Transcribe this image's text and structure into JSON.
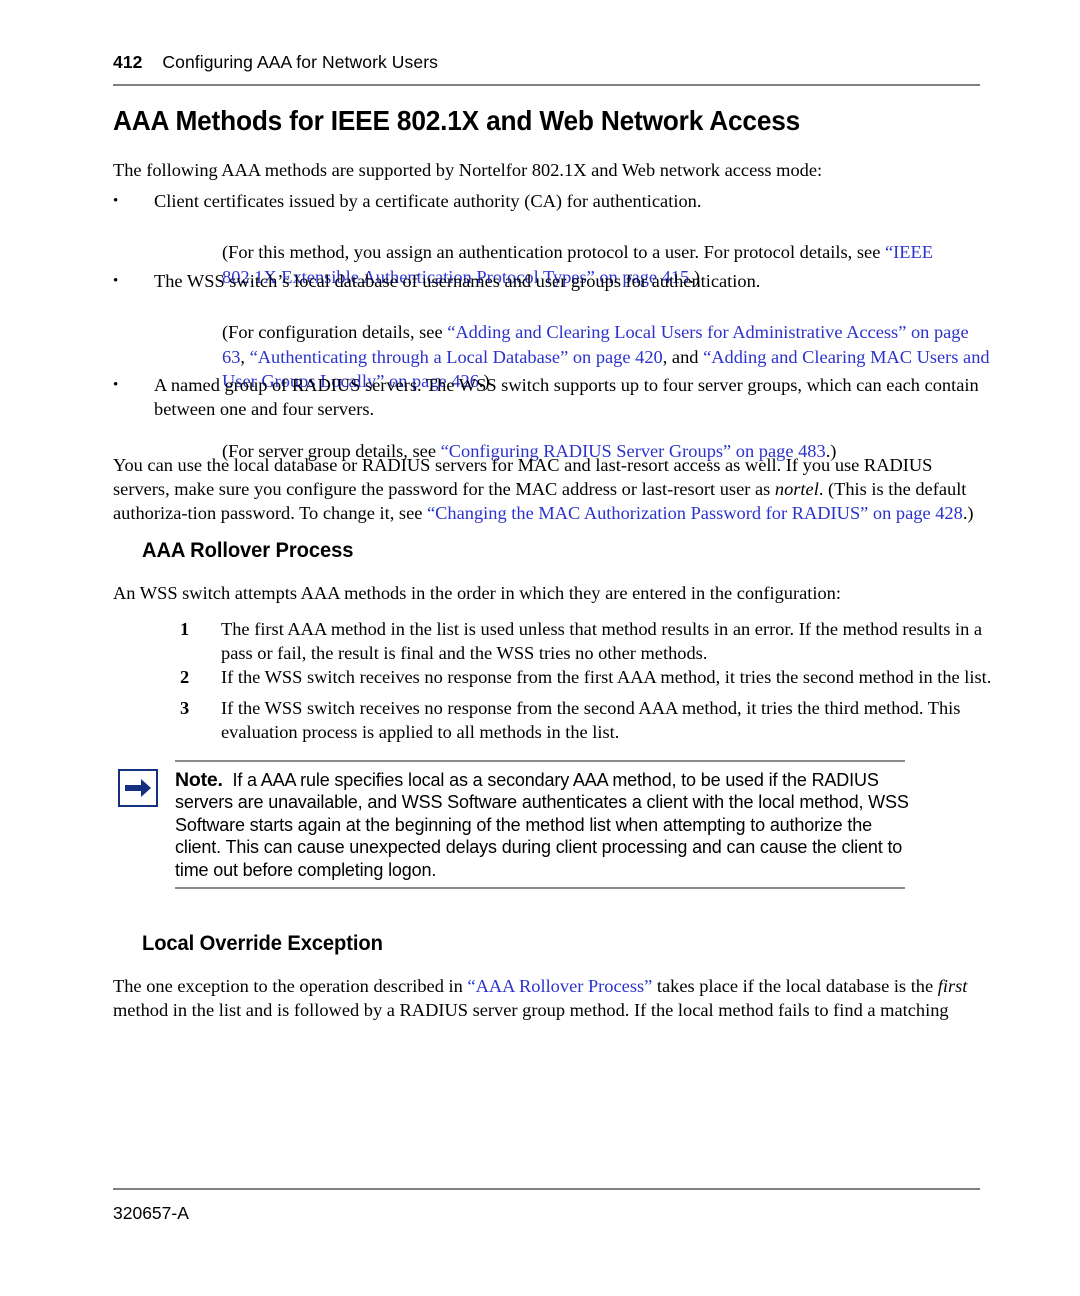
{
  "header": {
    "page_number": "412",
    "title": "Configuring AAA for Network Users"
  },
  "headings": {
    "h1": "AAA Methods for IEEE 802.1X and Web Network Access",
    "rollover": "AAA Rollover Process",
    "override": "Local Override Exception"
  },
  "intro": "The following AAA methods are supported by Nortelfor 802.1X and Web network access mode:",
  "bullets": [
    {
      "marker": "•",
      "text": "Client certificates issued by a certificate authority (CA) for authentication."
    },
    {
      "marker": "•",
      "text": "The WSS switch’s local database of usernames and user groups for authentication."
    },
    {
      "marker": "•",
      "text": "A named group of RADIUS servers. The WSS switch supports up to four server groups, which can each contain between one and four servers."
    }
  ],
  "notes_indented": {
    "note1": {
      "pre": "(For this method, you assign an authentication protocol to a user. For protocol details, see ",
      "link": "“IEEE 802.1X Extensible Authentication Protocol Types” on page 415",
      "post": ".)"
    },
    "note2": {
      "pre": "(For configuration details, see ",
      "link1": "“Adding and Clearing Local Users for Administrative Access” on page 63",
      "sep1": ", ",
      "link2": "“Authenticating through a Local Database” on page 420",
      "sep2": ", and ",
      "link3": "“Adding and Clearing MAC Users and User Groups Locally” on page 426",
      "post": ".)"
    },
    "note3": {
      "pre": "(For server group details, see ",
      "link": "“Configuring RADIUS Server Groups” on page 483",
      "post": ".)"
    }
  },
  "radius_para": {
    "part1": "You can use the local database or RADIUS servers for MAC and last-resort access as well. If you use RADIUS servers, make sure you configure the password for the MAC address or last-resort user as ",
    "italic": "nortel",
    "part2": ". (This is the default authoriza-tion password. To change it, see ",
    "link": "“Changing the MAC Authorization Password for RADIUS” on page 428",
    "part3": ".)"
  },
  "rollover_intro": "An WSS switch attempts AAA methods in the order in which they are entered in the configuration:",
  "steps": [
    {
      "number": "1",
      "text": "The first AAA method in the list is used unless that method results in an error. If the method results in a pass or fail, the result is final and the WSS tries no other methods."
    },
    {
      "number": "2",
      "text": "If the WSS switch receives no response from the first AAA method, it tries the second method in the list."
    },
    {
      "number": "3",
      "text": "If the WSS switch receives no response from the second AAA method, it tries the third method. This evaluation process is applied to all methods in the list."
    }
  ],
  "note_callout": {
    "icon": "right-arrow-icon",
    "label": "Note.",
    "text": "If a AAA rule specifies local as a secondary AAA method, to be used if the RADIUS servers are unavailable, and WSS Software authenticates a client with the local method, WSS Software starts again at the beginning of the method list when attempting to authorize the client. This can cause unexpected delays during client processing and can cause the client to time out before completing logon.",
    "accent_color": "#15307e"
  },
  "override_para": {
    "part1": "The one exception to the operation described in ",
    "link": "“AAA Rollover Process”",
    "part2": " takes place if the local database is the ",
    "italic": "first",
    "part3": " method in the list and is followed by a RADIUS server group method. If the local method fails to find a matching"
  },
  "footer": {
    "doc_id": "320657-A"
  },
  "colors": {
    "link": "#2b33cc",
    "rule": "#808080",
    "note_rule": "#8c8c8c"
  }
}
